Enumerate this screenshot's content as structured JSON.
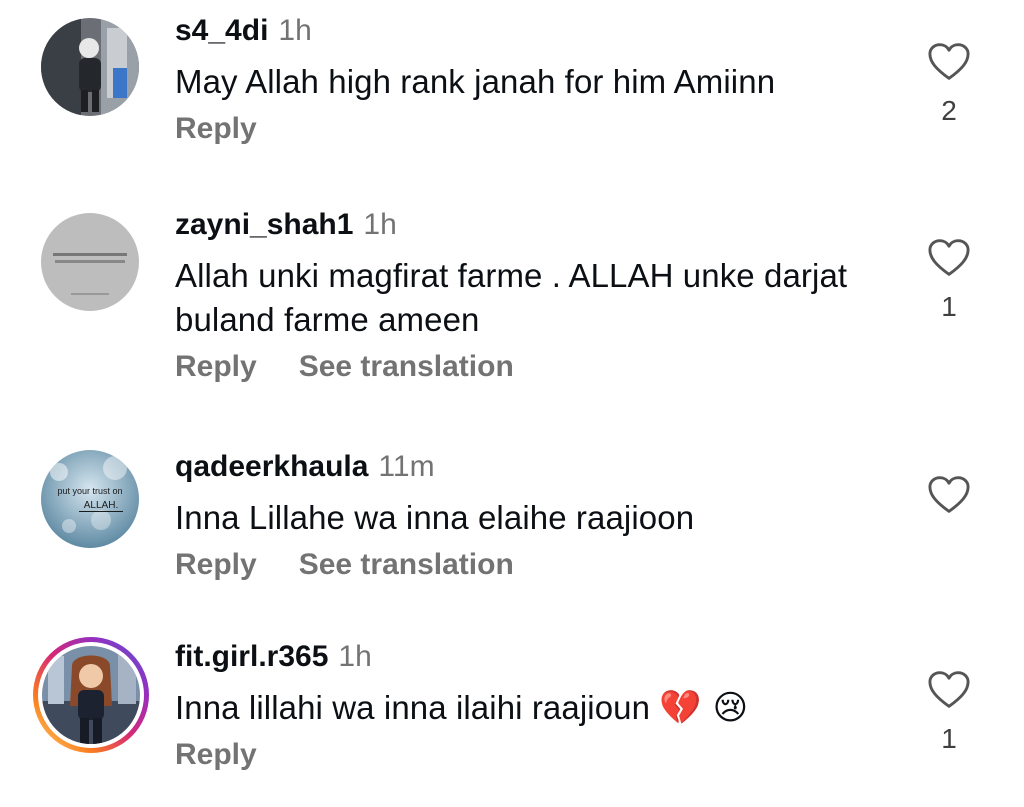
{
  "comments": [
    {
      "username": "s4_4di",
      "time": "1h",
      "text": "May Allah high rank janah for him Amiinn",
      "reply_label": "Reply",
      "like_count": "2",
      "avatar": "photo-person-avatar"
    },
    {
      "username": "zayni_shah1",
      "time": "1h",
      "text": "Allah unki magfirat farme . ALLAH unke darjat buland farme ameen",
      "reply_label": "Reply",
      "translate_label": "See translation",
      "like_count": "1",
      "avatar": "grey-text-avatar"
    },
    {
      "username": "qadeerkhaula",
      "time": "11m",
      "text": "Inna Lillahe wa inna elaihe raajioon",
      "reply_label": "Reply",
      "translate_label": "See translation",
      "avatar": "bokeh-text-avatar",
      "avatar_text_1": "put your trust on",
      "avatar_text_2": "ALLAH."
    },
    {
      "username": "fit.girl.r365",
      "time": "1h",
      "text": "Inna lillahi wa inna ilaihi raajioun",
      "emoji": "💔 😢",
      "reply_label": "Reply",
      "like_count": "1",
      "avatar": "story-ring-avatar"
    }
  ],
  "icons": {
    "like": "heart-outline-icon"
  },
  "colors": {
    "secondary_text": "#737373",
    "primary_text": "#0c1014",
    "story_ring": "#d62976"
  }
}
